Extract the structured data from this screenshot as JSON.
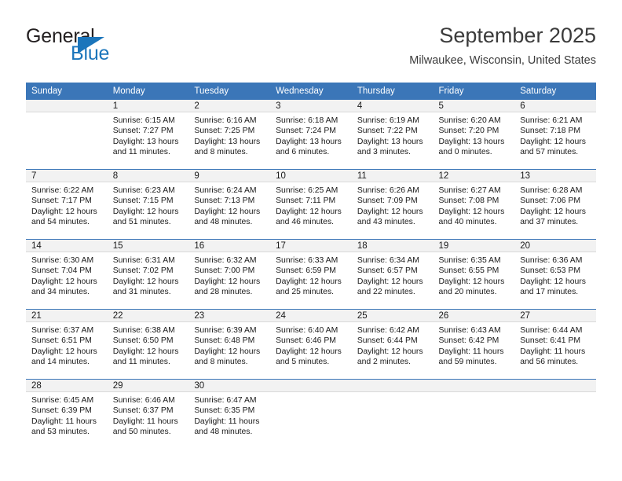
{
  "logo": {
    "word_top": "General",
    "word_bottom": "Blue",
    "accent_color": "#1b75bb",
    "triangle_icon": "triangle-icon"
  },
  "header": {
    "title": "September 2025",
    "subtitle": "Milwaukee, Wisconsin, United States"
  },
  "theme": {
    "header_blue": "#3b76b8",
    "daynum_band": "#f2f2f2"
  },
  "weekday_headers": [
    "Sunday",
    "Monday",
    "Tuesday",
    "Wednesday",
    "Thursday",
    "Friday",
    "Saturday"
  ],
  "weeks": [
    [
      {
        "day": "",
        "lines": []
      },
      {
        "day": "1",
        "lines": [
          "Sunrise: 6:15 AM",
          "Sunset: 7:27 PM",
          "Daylight: 13 hours",
          "and 11 minutes."
        ]
      },
      {
        "day": "2",
        "lines": [
          "Sunrise: 6:16 AM",
          "Sunset: 7:25 PM",
          "Daylight: 13 hours",
          "and 8 minutes."
        ]
      },
      {
        "day": "3",
        "lines": [
          "Sunrise: 6:18 AM",
          "Sunset: 7:24 PM",
          "Daylight: 13 hours",
          "and 6 minutes."
        ]
      },
      {
        "day": "4",
        "lines": [
          "Sunrise: 6:19 AM",
          "Sunset: 7:22 PM",
          "Daylight: 13 hours",
          "and 3 minutes."
        ]
      },
      {
        "day": "5",
        "lines": [
          "Sunrise: 6:20 AM",
          "Sunset: 7:20 PM",
          "Daylight: 13 hours",
          "and 0 minutes."
        ]
      },
      {
        "day": "6",
        "lines": [
          "Sunrise: 6:21 AM",
          "Sunset: 7:18 PM",
          "Daylight: 12 hours",
          "and 57 minutes."
        ]
      }
    ],
    [
      {
        "day": "7",
        "lines": [
          "Sunrise: 6:22 AM",
          "Sunset: 7:17 PM",
          "Daylight: 12 hours",
          "and 54 minutes."
        ]
      },
      {
        "day": "8",
        "lines": [
          "Sunrise: 6:23 AM",
          "Sunset: 7:15 PM",
          "Daylight: 12 hours",
          "and 51 minutes."
        ]
      },
      {
        "day": "9",
        "lines": [
          "Sunrise: 6:24 AM",
          "Sunset: 7:13 PM",
          "Daylight: 12 hours",
          "and 48 minutes."
        ]
      },
      {
        "day": "10",
        "lines": [
          "Sunrise: 6:25 AM",
          "Sunset: 7:11 PM",
          "Daylight: 12 hours",
          "and 46 minutes."
        ]
      },
      {
        "day": "11",
        "lines": [
          "Sunrise: 6:26 AM",
          "Sunset: 7:09 PM",
          "Daylight: 12 hours",
          "and 43 minutes."
        ]
      },
      {
        "day": "12",
        "lines": [
          "Sunrise: 6:27 AM",
          "Sunset: 7:08 PM",
          "Daylight: 12 hours",
          "and 40 minutes."
        ]
      },
      {
        "day": "13",
        "lines": [
          "Sunrise: 6:28 AM",
          "Sunset: 7:06 PM",
          "Daylight: 12 hours",
          "and 37 minutes."
        ]
      }
    ],
    [
      {
        "day": "14",
        "lines": [
          "Sunrise: 6:30 AM",
          "Sunset: 7:04 PM",
          "Daylight: 12 hours",
          "and 34 minutes."
        ]
      },
      {
        "day": "15",
        "lines": [
          "Sunrise: 6:31 AM",
          "Sunset: 7:02 PM",
          "Daylight: 12 hours",
          "and 31 minutes."
        ]
      },
      {
        "day": "16",
        "lines": [
          "Sunrise: 6:32 AM",
          "Sunset: 7:00 PM",
          "Daylight: 12 hours",
          "and 28 minutes."
        ]
      },
      {
        "day": "17",
        "lines": [
          "Sunrise: 6:33 AM",
          "Sunset: 6:59 PM",
          "Daylight: 12 hours",
          "and 25 minutes."
        ]
      },
      {
        "day": "18",
        "lines": [
          "Sunrise: 6:34 AM",
          "Sunset: 6:57 PM",
          "Daylight: 12 hours",
          "and 22 minutes."
        ]
      },
      {
        "day": "19",
        "lines": [
          "Sunrise: 6:35 AM",
          "Sunset: 6:55 PM",
          "Daylight: 12 hours",
          "and 20 minutes."
        ]
      },
      {
        "day": "20",
        "lines": [
          "Sunrise: 6:36 AM",
          "Sunset: 6:53 PM",
          "Daylight: 12 hours",
          "and 17 minutes."
        ]
      }
    ],
    [
      {
        "day": "21",
        "lines": [
          "Sunrise: 6:37 AM",
          "Sunset: 6:51 PM",
          "Daylight: 12 hours",
          "and 14 minutes."
        ]
      },
      {
        "day": "22",
        "lines": [
          "Sunrise: 6:38 AM",
          "Sunset: 6:50 PM",
          "Daylight: 12 hours",
          "and 11 minutes."
        ]
      },
      {
        "day": "23",
        "lines": [
          "Sunrise: 6:39 AM",
          "Sunset: 6:48 PM",
          "Daylight: 12 hours",
          "and 8 minutes."
        ]
      },
      {
        "day": "24",
        "lines": [
          "Sunrise: 6:40 AM",
          "Sunset: 6:46 PM",
          "Daylight: 12 hours",
          "and 5 minutes."
        ]
      },
      {
        "day": "25",
        "lines": [
          "Sunrise: 6:42 AM",
          "Sunset: 6:44 PM",
          "Daylight: 12 hours",
          "and 2 minutes."
        ]
      },
      {
        "day": "26",
        "lines": [
          "Sunrise: 6:43 AM",
          "Sunset: 6:42 PM",
          "Daylight: 11 hours",
          "and 59 minutes."
        ]
      },
      {
        "day": "27",
        "lines": [
          "Sunrise: 6:44 AM",
          "Sunset: 6:41 PM",
          "Daylight: 11 hours",
          "and 56 minutes."
        ]
      }
    ],
    [
      {
        "day": "28",
        "lines": [
          "Sunrise: 6:45 AM",
          "Sunset: 6:39 PM",
          "Daylight: 11 hours",
          "and 53 minutes."
        ]
      },
      {
        "day": "29",
        "lines": [
          "Sunrise: 6:46 AM",
          "Sunset: 6:37 PM",
          "Daylight: 11 hours",
          "and 50 minutes."
        ]
      },
      {
        "day": "30",
        "lines": [
          "Sunrise: 6:47 AM",
          "Sunset: 6:35 PM",
          "Daylight: 11 hours",
          "and 48 minutes."
        ]
      },
      {
        "day": "",
        "lines": []
      },
      {
        "day": "",
        "lines": []
      },
      {
        "day": "",
        "lines": []
      },
      {
        "day": "",
        "lines": []
      }
    ]
  ]
}
